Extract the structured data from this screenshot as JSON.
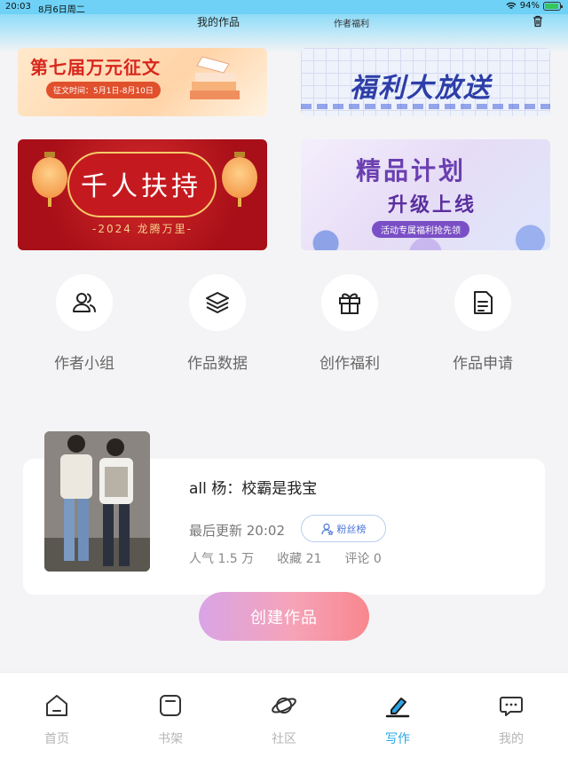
{
  "status_bar": {
    "time": "20:03",
    "date": "8月6日周二",
    "battery": "94%",
    "battery_level": 0.94
  },
  "header": {
    "tab_works": "我的作品",
    "tab_welfare": "作者福利",
    "trash_icon": "trash-icon"
  },
  "banners": {
    "essay_contest": {
      "title": "第七届万元征文",
      "date": "征文时间：5月1日-8月10日"
    },
    "welfare": {
      "title": "福利大放送"
    },
    "support": {
      "title": "千人扶持",
      "subtitle": "-2024 龙腾万里-"
    },
    "premium": {
      "title": "精品计划",
      "subtitle": "升级上线",
      "tag": "活动专属福利抢先领"
    }
  },
  "actions": [
    {
      "label": "作者小组",
      "icon": "author-group-icon"
    },
    {
      "label": "作品数据",
      "icon": "layers-icon"
    },
    {
      "label": "创作福利",
      "icon": "gift-icon"
    },
    {
      "label": "作品申请",
      "icon": "document-icon"
    }
  ],
  "work": {
    "title": "all 杨：校霸是我宝",
    "updated": "最后更新 20:02",
    "fans_button": "粉丝榜",
    "popularity": "人气 1.5 万",
    "favorites": "收藏 21",
    "comments": "评论 0"
  },
  "create_button": "创建作品",
  "tabbar": [
    {
      "label": "首页",
      "icon": "home-icon",
      "active": false
    },
    {
      "label": "书架",
      "icon": "bookshelf-icon",
      "active": false
    },
    {
      "label": "社区",
      "icon": "planet-icon",
      "active": false
    },
    {
      "label": "写作",
      "icon": "pen-icon",
      "active": true
    },
    {
      "label": "我的",
      "icon": "chat-bubble-icon",
      "active": false
    }
  ],
  "colors": {
    "accent": "#2aa7e8",
    "header_top": "#6ed1f5",
    "create_gradient_start": "#d9a4e6",
    "create_gradient_end": "#f8878e"
  }
}
